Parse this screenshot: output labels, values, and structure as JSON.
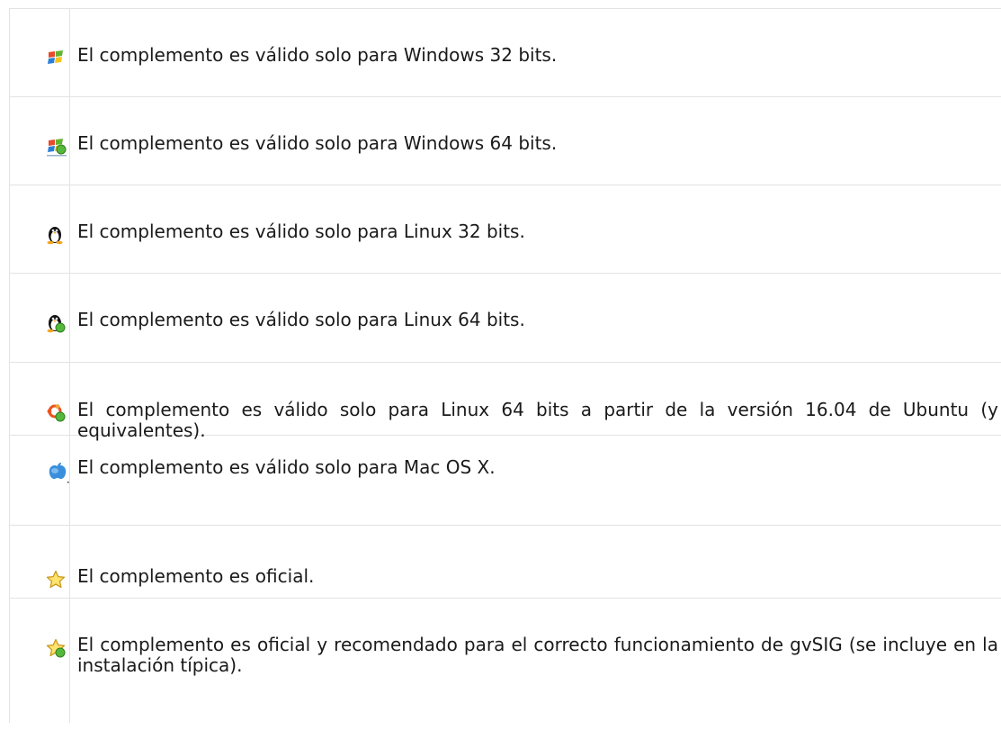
{
  "rows": [
    {
      "icon": "windows-32-icon",
      "text": "El complemento es válido solo para Windows 32 bits."
    },
    {
      "icon": "windows-64-icon",
      "text": "El complemento es válido solo para Windows 64 bits."
    },
    {
      "icon": "linux-32-icon",
      "text": "El complemento es válido solo para Linux 32 bits."
    },
    {
      "icon": "linux-64-icon",
      "text": "El complemento es válido solo para Linux 64 bits."
    },
    {
      "icon": "ubuntu-64-icon",
      "text": "El complemento es válido solo para Linux 64 bits a partir de la versión 16.04 de Ubuntu (y equivalentes)."
    },
    {
      "icon": "mac-os-x-icon",
      "text": "El complemento es válido solo para Mac OS X."
    },
    {
      "icon": "official-star-icon",
      "text": "El complemento es oficial."
    },
    {
      "icon": "official-recommended-star-icon",
      "text": "El complemento es oficial y recomendado para el correcto funcionamiento de gvSIG (se incluye en la instalación típica)."
    }
  ],
  "colors": {
    "border": "#e3e3e3",
    "text": "#1a1a1a",
    "star_fill": "#ffe36e",
    "star_stroke": "#c99a1b",
    "badge_green": "#55b83a"
  }
}
